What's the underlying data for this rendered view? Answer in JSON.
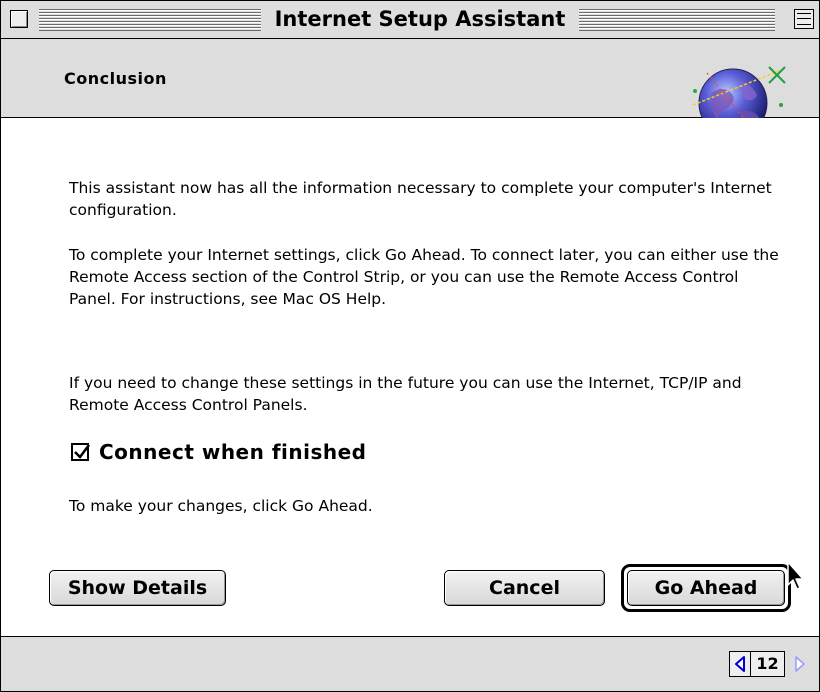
{
  "window": {
    "title": "Internet Setup Assistant"
  },
  "header": {
    "title": "Conclusion",
    "icon": "globe-icon"
  },
  "content": {
    "paragraphs": [
      "This assistant now has all the information necessary to complete your computer's Internet configuration.",
      "To complete your Internet settings, click Go Ahead.  To connect later, you can either use the Remote Access section of the Control Strip, or you can use the Remote Access Control Panel.  For instructions, see Mac OS Help.",
      "If you need to change these settings in the future you can use the Internet, TCP/IP and Remote Access Control Panels.",
      "To make your changes, click Go Ahead."
    ],
    "checkbox": {
      "label": "Connect when finished",
      "checked": true
    }
  },
  "buttons": {
    "show_details": "Show Details",
    "cancel": "Cancel",
    "go_ahead": "Go Ahead"
  },
  "footer": {
    "page_number": "12",
    "prev_icon": "triangle-left-icon",
    "next_icon": "triangle-right-icon"
  },
  "colors": {
    "window_bg": "#dddddd",
    "content_bg": "#ffffff",
    "pager_prev_arrow": "#0000cc",
    "pager_next_arrow_disabled": "#9a9aff"
  }
}
